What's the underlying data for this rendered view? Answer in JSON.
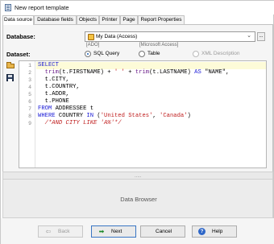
{
  "window": {
    "title": "New report template"
  },
  "tabs": [
    {
      "label": "Data source",
      "active": true
    },
    {
      "label": "Database fields",
      "active": false
    },
    {
      "label": "Objects",
      "active": false
    },
    {
      "label": "Printer",
      "active": false
    },
    {
      "label": "Page",
      "active": false
    },
    {
      "label": "Report Properties",
      "active": false
    }
  ],
  "database": {
    "label": "Database:",
    "selected": "My Data (Access)",
    "browse_label": "...",
    "provider": "[ADO]",
    "type": "[Microsoft Access]"
  },
  "dataset": {
    "label": "Dataset:",
    "options": [
      {
        "label": "SQL Query",
        "selected": true,
        "enabled": true
      },
      {
        "label": "Table",
        "selected": false,
        "enabled": true
      },
      {
        "label": "XML Description",
        "selected": false,
        "enabled": false
      }
    ]
  },
  "editor": {
    "current_line": 1,
    "lines": [
      {
        "n": "1",
        "text": "SELECT"
      },
      {
        "n": "2",
        "text": "  trim(t.FIRSTNAME) + ' ' + trim(t.LASTNAME) AS \"NAME\","
      },
      {
        "n": "3",
        "text": "  t.CITY,"
      },
      {
        "n": "4",
        "text": "  t.COUNTRY,"
      },
      {
        "n": "5",
        "text": "  t.ADDR,"
      },
      {
        "n": "6",
        "text": "  t.PHONE"
      },
      {
        "n": "7",
        "text": "FROM ADDRESSEE t"
      },
      {
        "n": "8",
        "text": "WHERE COUNTRY IN ('United States', 'Canada')"
      },
      {
        "n": "9",
        "text": "  /*AND CITY LIKE 'A%'*/"
      }
    ]
  },
  "splitter": {
    "grip": "....."
  },
  "browser": {
    "title": "Data Browser"
  },
  "buttons": {
    "back": "Back",
    "next": "Next",
    "cancel": "Cancel",
    "help": "Help"
  },
  "icons": {
    "app": "report-icon",
    "database": "access-database-icon",
    "open": "open-folder-icon",
    "save": "save-disk-icon",
    "back": "arrow-left-icon",
    "next": "arrow-right-icon",
    "help": "help-icon"
  },
  "colors": {
    "keyword": "#1b1bd6",
    "function": "#6c1f8a",
    "string": "#c01e1e",
    "comment": "#c01e1e",
    "current_line": "#fdfbd8",
    "next_arrow": "#1a8a2a",
    "help_icon": "#2f67c8"
  }
}
